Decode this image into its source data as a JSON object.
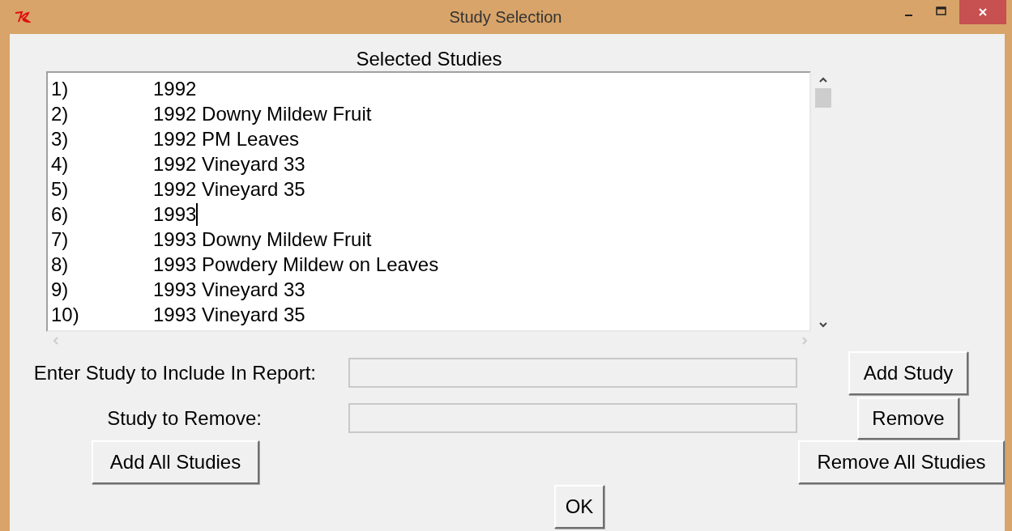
{
  "window": {
    "title": "Study Selection"
  },
  "listbox": {
    "heading": "Selected Studies",
    "items": [
      {
        "number": "1)",
        "name": "1992",
        "cursor": false
      },
      {
        "number": "2)",
        "name": "1992 Downy Mildew Fruit",
        "cursor": false
      },
      {
        "number": "3)",
        "name": "1992 PM Leaves",
        "cursor": false
      },
      {
        "number": "4)",
        "name": "1992 Vineyard 33",
        "cursor": false
      },
      {
        "number": "5)",
        "name": "1992 Vineyard 35",
        "cursor": false
      },
      {
        "number": "6)",
        "name": "1993",
        "cursor": true
      },
      {
        "number": "7)",
        "name": "1993 Downy Mildew Fruit",
        "cursor": false
      },
      {
        "number": "8)",
        "name": "1993 Powdery Mildew on Leaves",
        "cursor": false
      },
      {
        "number": "9)",
        "name": "1993 Vineyard 33",
        "cursor": false
      },
      {
        "number": "10)",
        "name": "1993 Vineyard 35",
        "cursor": false
      }
    ]
  },
  "include": {
    "label": "Enter Study to Include In Report:",
    "button": "Add Study"
  },
  "remove": {
    "label": "Study to Remove:",
    "button": "Remove"
  },
  "buttons": {
    "add_all": "Add All Studies",
    "remove_all": "Remove All Studies",
    "ok": "OK"
  }
}
